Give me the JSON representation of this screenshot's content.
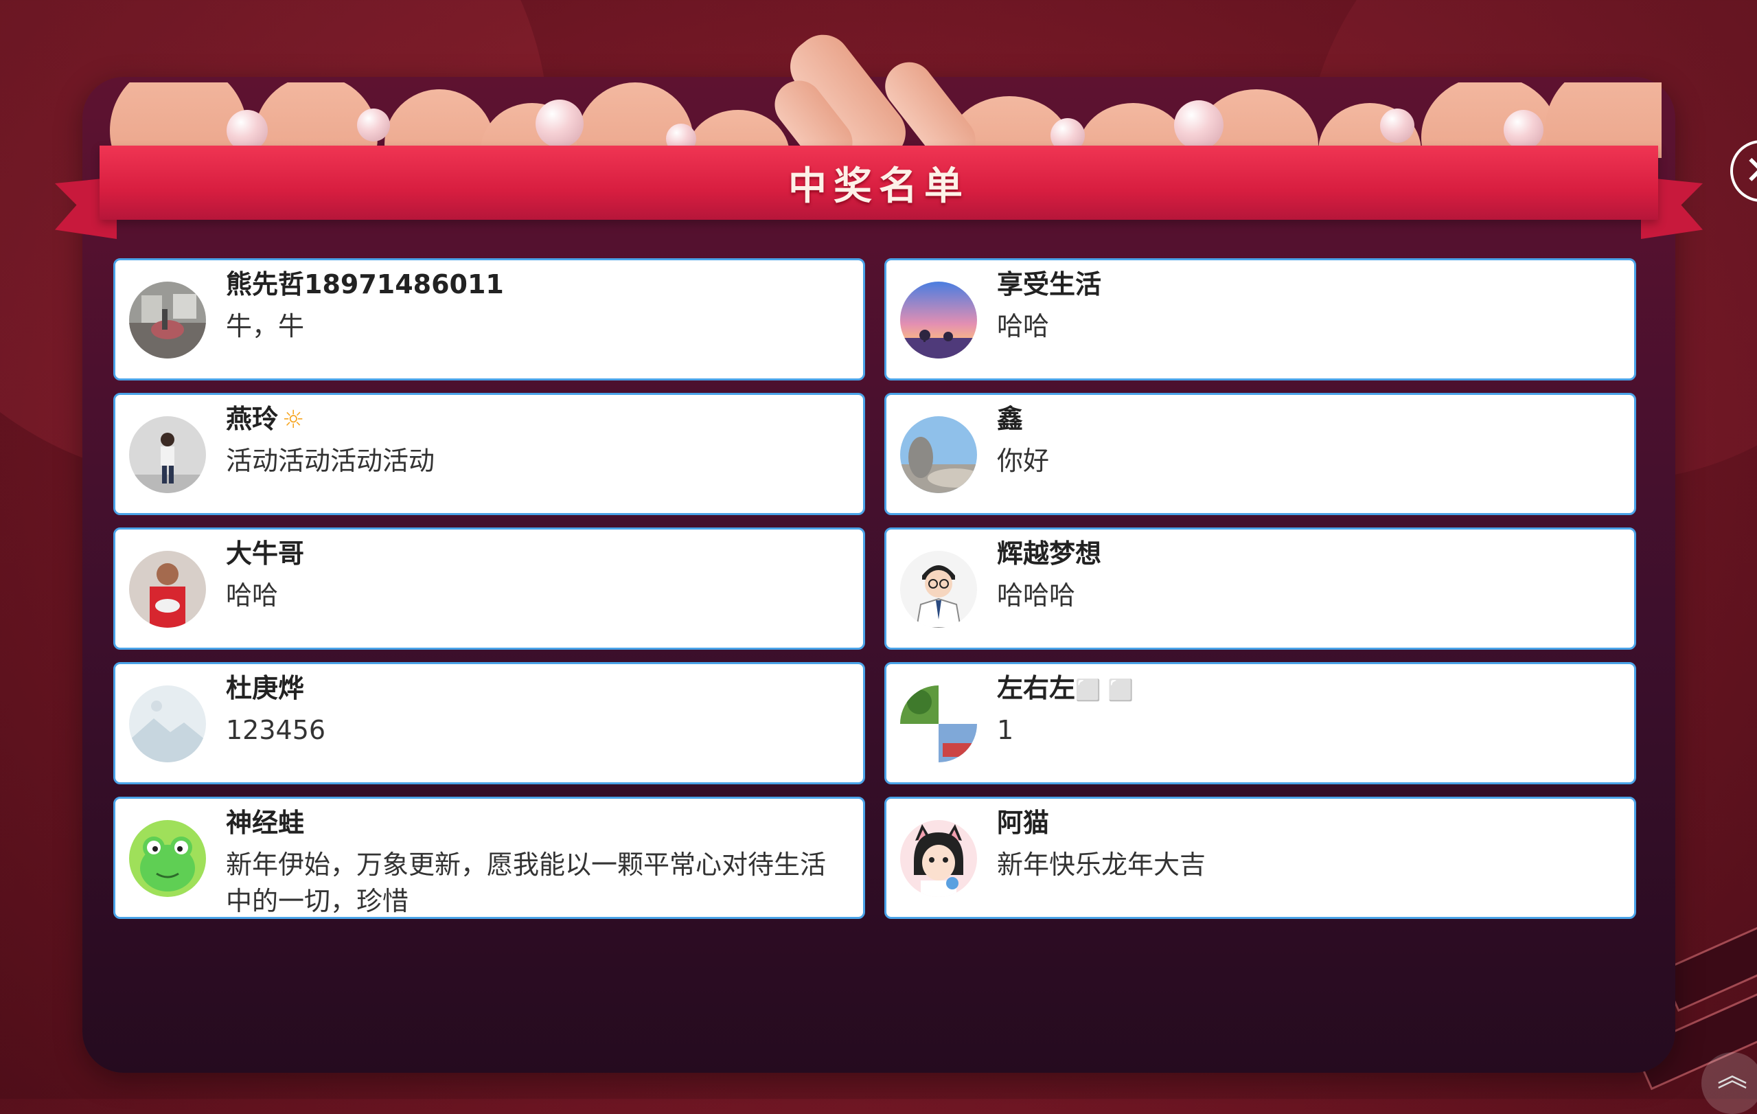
{
  "title": "中奖名单",
  "close_symbol": "✕",
  "scroll_top_symbol": "︽",
  "winners": [
    {
      "name": "熊先哲18971486011",
      "message": "牛，牛",
      "avatar": "dental-clinic-photo"
    },
    {
      "name": "享受生活",
      "message": "哈哈",
      "avatar": "sunset-landscape-photo"
    },
    {
      "name": "燕玲",
      "name_icon": "☼",
      "message": "活动活动活动活动",
      "avatar": "woman-portrait-photo"
    },
    {
      "name": "鑫",
      "message": "你好",
      "avatar": "beach-rocks-photo"
    },
    {
      "name": "大牛哥",
      "message": "哈哈",
      "avatar": "man-red-shirt-photo"
    },
    {
      "name": "辉越梦想",
      "message": "哈哈哈",
      "avatar": "cartoon-doctor"
    },
    {
      "name": "杜庚烨",
      "message": "123456",
      "avatar": "placeholder-image"
    },
    {
      "name": "左右左",
      "name_suffix": "⬜ ⬜",
      "message": "1",
      "avatar": "tree-collage-photo"
    },
    {
      "name": "神经蛙",
      "message": "新年伊始，万象更新，愿我能以一颗平常心对待生活中的一切，珍惜",
      "avatar": "green-frog-cartoon"
    },
    {
      "name": "阿猫",
      "message": "新年快乐龙年大吉",
      "avatar": "cat-girl-cartoon"
    }
  ],
  "colors": {
    "background": "#6a1522",
    "modal": "#3d0f2c",
    "ribbon": "#e0263f",
    "card_border": "#4aa3e8"
  }
}
